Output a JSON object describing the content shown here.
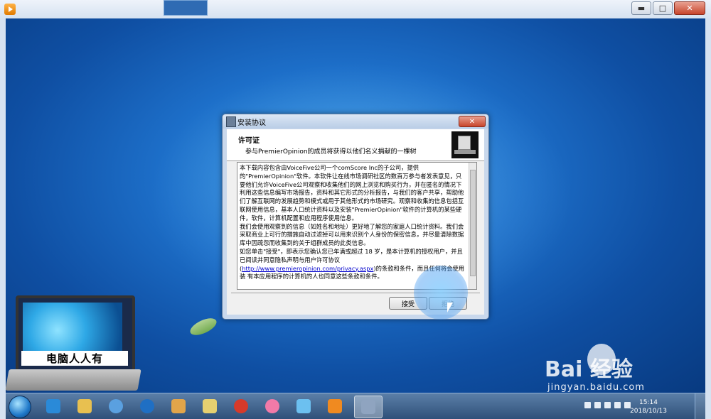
{
  "window": {
    "minimize": "▬",
    "maximize": "□",
    "close": "✕"
  },
  "dialog": {
    "title": "安装协议",
    "header_title": "许可证",
    "header_subtitle": "参与PremierOpinion的成员将获得以他们名义捐献的一棵树",
    "license": {
      "p1": "本下载内容包含由VoiceFive公司一个comScore Inc的子公司，提供的\"PremierOpinion\"软件。本软件让在线市场调研社区的数百万参与者发表意见，只要他们允许VoiceFive公司观察和收集他们的网上浏览和购买行为，并在匿名的情况下利用这些信息编写市场报告，资料和其它形式的分析报告，与我们的客户共享，帮助他们了解互联网的发展趋势和模式或用于其他形式的市场研究。观察和收集的信息包括互联网使用信息，基本人口统计资料以及安装\"PremierOpinion\"软件的计算机的某些硬件，软件，计算机配置和应用程序使用信息。",
      "p2": "我们会使用观察到的信息（如姓名和地址）更好地了解您的家庭人口统计资料。我们会采取商业上可行的措施自动过滤掉可以用来识别个人身份的保密信息，并尽量清除数据库中因疏忽而收集到的关于组群成员的此类信息。",
      "p3a": "如您单击\"接受\"，即表示您确认您已年满或超过 18 岁，是本计算机的授权用户，并且已阅读并同意隐私声明与用户许可协议(",
      "link": "http://www.premieropinion.com/privacy.aspx",
      "p3b": ")的条款和条件，而且任何将会使用装 有本应用程序的计算机的人也同意这些条款和条件。"
    },
    "accept_button": "接受",
    "decline_button": "拒绝"
  },
  "decoration": {
    "laptop_caption": "电脑人人有"
  },
  "watermark": {
    "brand": "Bai  经验",
    "url": "jingyan.baidu.com"
  },
  "taskbar": {
    "clock_time": "15:14",
    "clock_date": "2018/10/13",
    "items": [
      "ie-icon",
      "file-explorer-icon",
      "network-icon",
      "ie-icon",
      "paint-icon",
      "folder-icon",
      "game-icon",
      "game-icon",
      "game-icon",
      "media-player-icon",
      "installer-icon"
    ]
  }
}
